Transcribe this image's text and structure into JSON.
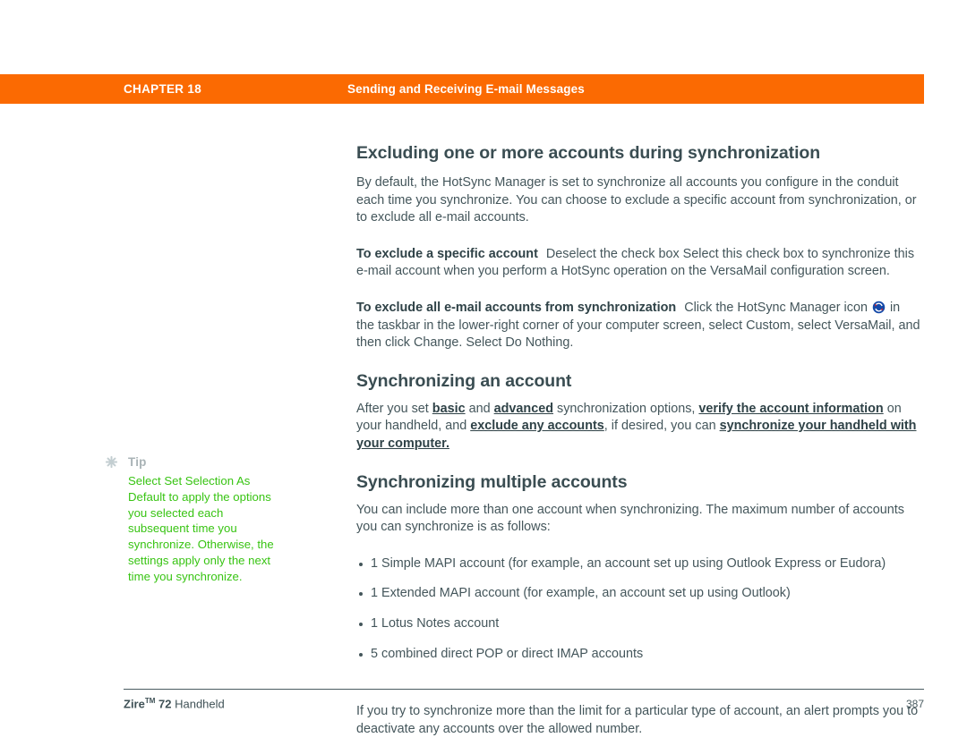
{
  "header": {
    "chapter_label": "CHAPTER 18",
    "topic": "Sending and Receiving E-mail Messages",
    "bar_color": "#fb6a02"
  },
  "sections": [
    {
      "title": "Excluding one or more accounts during synchronization",
      "intro": "By default, the HotSync Manager is set to synchronize all accounts you configure in the conduit each time you synchronize. You can choose to exclude a specific account from synchronization, or to exclude all e-mail accounts.",
      "para_specific": {
        "lead_in": "To exclude a specific account",
        "text": "Deselect the check box Select this check box to synchronize this e-mail account when you perform a HotSync operation on the VersaMail configuration screen."
      },
      "para_all": {
        "lead_in": "To exclude all e-mail accounts from synchronization",
        "text_before_icon": "Click the HotSync Manager icon",
        "icon_name": "hotsync-icon",
        "text_after_icon": "in the taskbar in the lower-right corner of your computer screen, select Custom, select VersaMail, and then click Change. Select Do Nothing."
      }
    },
    {
      "title": "Synchronizing an account",
      "parts": {
        "p1": "After you set ",
        "link1": "basic",
        "p2": " and ",
        "link2": "advanced",
        "p3": " synchronization options, ",
        "link3": "verify the account information",
        "p4": " on your handheld, and ",
        "link4": "exclude any accounts",
        "p5": ", if desired, you can ",
        "link5": "synchronize your handheld with your computer."
      }
    },
    {
      "title": "Synchronizing multiple accounts",
      "intro": "You can include more than one account when synchronizing. The maximum number of accounts you can synchronize is as follows:",
      "bullets": [
        "1 Simple MAPI account (for example, an account set up using Outlook Express or Eudora)",
        "1 Extended MAPI account (for example, an account set up using Outlook)",
        "1 Lotus Notes account",
        "5 combined direct POP or direct IMAP accounts"
      ],
      "closing": "If you try to synchronize more than the limit for a particular type of account, an alert prompts you to deactivate any accounts over the allowed number."
    }
  ],
  "tip": {
    "icon_name": "asterisk-icon",
    "label": "Tip",
    "text": "Select Set Selection As Default to apply the options you selected each subsequent time you synchronize. Otherwise, the settings apply only the next time you synchronize.",
    "text_color": "#38c413"
  },
  "footer": {
    "product": "Zire",
    "trademark": "TM",
    "model": " 72",
    "product_suffix": " Handheld",
    "page_number": "387"
  }
}
